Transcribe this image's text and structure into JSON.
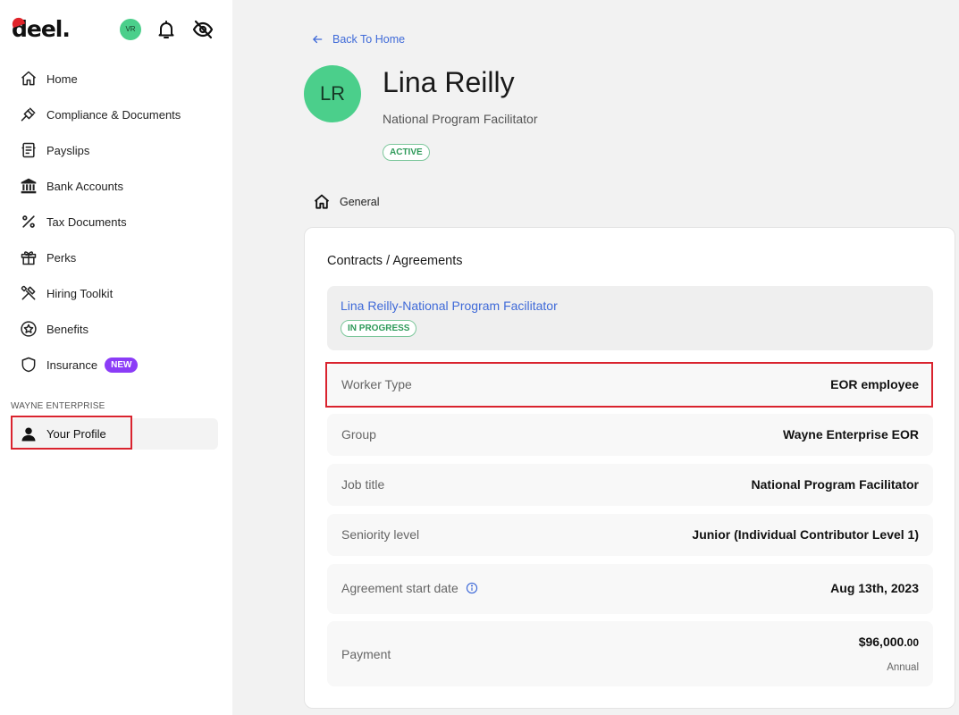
{
  "brand": {
    "logo_text": "deel.",
    "accent": "#e0242a"
  },
  "topbar": {
    "avatar_initials": "VR",
    "icons": [
      "bell-icon",
      "eye-off-icon"
    ]
  },
  "sidebar": {
    "items": [
      {
        "label": "Home",
        "icon": "home-icon"
      },
      {
        "label": "Compliance & Documents",
        "icon": "gavel-icon"
      },
      {
        "label": "Payslips",
        "icon": "payslip-icon"
      },
      {
        "label": "Bank Accounts",
        "icon": "bank-icon"
      },
      {
        "label": "Tax Documents",
        "icon": "percent-icon"
      },
      {
        "label": "Perks",
        "icon": "gift-icon"
      },
      {
        "label": "Hiring Toolkit",
        "icon": "tools-icon"
      },
      {
        "label": "Benefits",
        "icon": "star-icon"
      },
      {
        "label": "Insurance",
        "icon": "shield-icon",
        "badge": "NEW"
      }
    ],
    "section_label": "WAYNE ENTERPRISE",
    "profile_label": "Your Profile"
  },
  "main": {
    "back_label": "Back To Home",
    "avatar_initials": "LR",
    "name": "Lina Reilly",
    "job_title": "National Program Facilitator",
    "status": "ACTIVE",
    "tab_general": "General",
    "card": {
      "title": "Contracts / Agreements",
      "agreement_link": "Lina Reilly-National Program Facilitator",
      "agreement_status": "IN PROGRESS",
      "rows": [
        {
          "key": "Worker Type",
          "value": "EOR employee"
        },
        {
          "key": "Group",
          "value": "Wayne Enterprise EOR"
        },
        {
          "key": "Job title",
          "value": "National Program Facilitator"
        },
        {
          "key": "Seniority level",
          "value": "Junior (Individual Contributor Level 1)"
        },
        {
          "key": "Agreement start date",
          "value": "Aug 13th, 2023"
        }
      ],
      "payment": {
        "key": "Payment",
        "amount_main": "$96,000",
        "amount_cents": ".00",
        "period": "Annual"
      }
    }
  },
  "colors": {
    "avatar_green": "#4bcf8b",
    "link_blue": "#3f6ad8",
    "highlight_red": "#d9232e",
    "badge_purple": "#8b3cf7"
  }
}
